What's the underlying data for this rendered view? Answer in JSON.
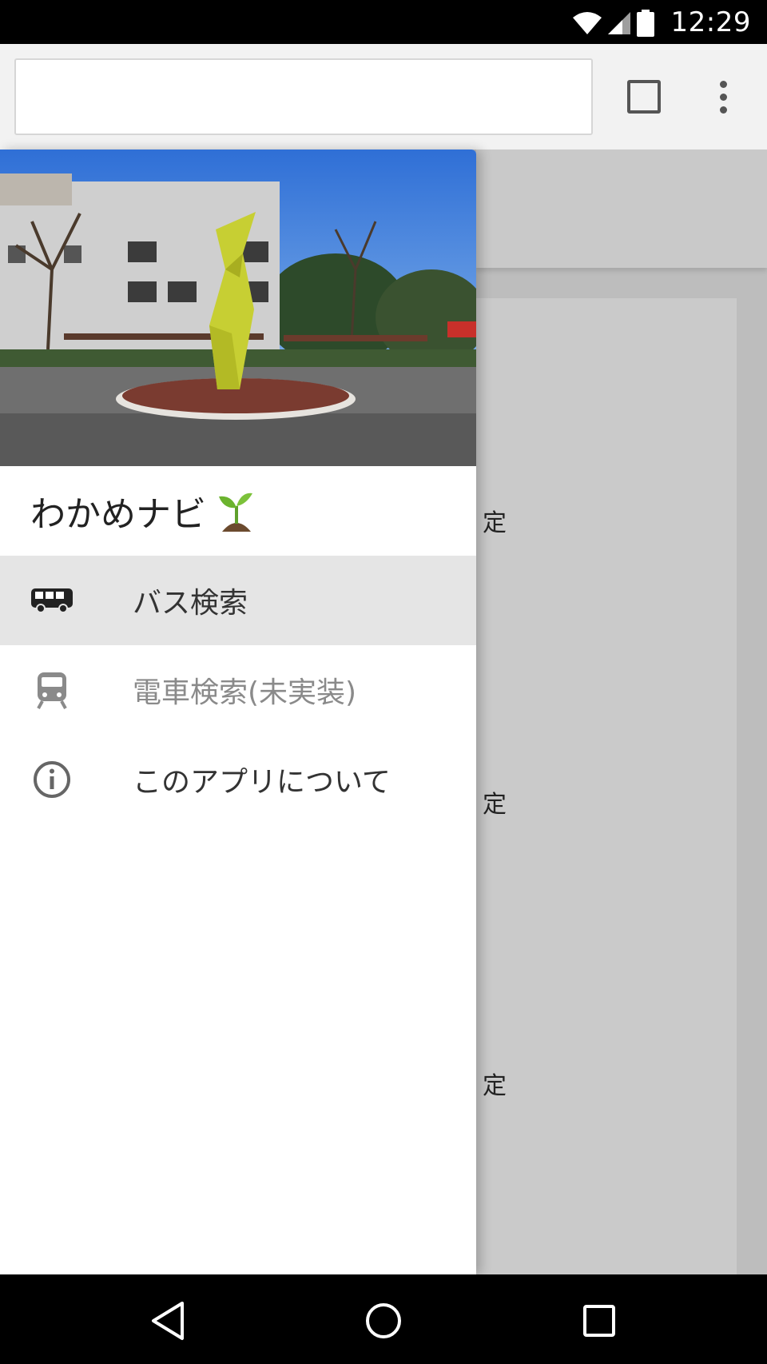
{
  "status_bar": {
    "time": "12:29",
    "icons": [
      "wifi-icon",
      "cell-signal-icon",
      "battery-icon"
    ]
  },
  "browser": {
    "url_value": "",
    "icons": [
      "tabs-icon",
      "overflow-menu-icon"
    ]
  },
  "drawer": {
    "app_title": "わかめナビ",
    "title_icon": "sprout-icon",
    "items": [
      {
        "label": "バス検索",
        "icon": "bus-icon",
        "active": true
      },
      {
        "label": "電車検索(未実装)",
        "icon": "train-icon",
        "disabled": true
      },
      {
        "label": "このアプリについて",
        "icon": "info-icon"
      }
    ]
  },
  "background_page": {
    "texts": [
      "定",
      "定",
      "定"
    ]
  },
  "colors": {
    "drawer_active": "#e5e5e5",
    "scrim": "#bdbdbd",
    "text": "#333333",
    "disabled_text": "#8a8a8a"
  }
}
